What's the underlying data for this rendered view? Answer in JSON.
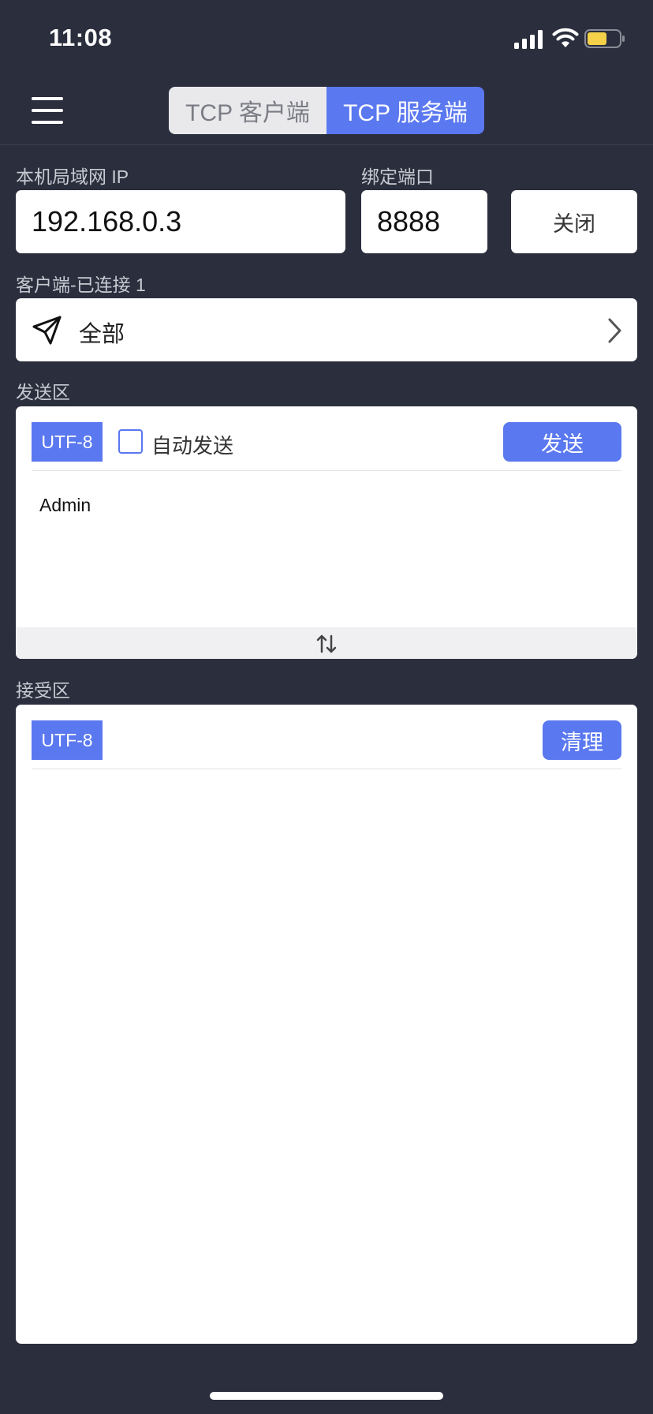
{
  "status_bar": {
    "time": "11:08",
    "icons": [
      "signal-icon",
      "wifi-icon",
      "battery-icon"
    ],
    "battery_color": "#f4d148"
  },
  "nav": {
    "menu_icon": "hamburger-menu-icon",
    "tabs": [
      {
        "label": "TCP 客户端",
        "active": false
      },
      {
        "label": "TCP 服务端",
        "active": true
      }
    ]
  },
  "server": {
    "ip_label": "本机局域网 IP",
    "ip_value": "192.168.0.3",
    "port_label": "绑定端口",
    "port_value": "8888",
    "close_label": "关闭"
  },
  "clients": {
    "label": "客户端-已连接 1",
    "selected": "全部",
    "icon": "send-target-icon"
  },
  "send_area": {
    "label": "发送区",
    "encoding": "UTF-8",
    "auto_send_label": "自动发送",
    "auto_send_checked": false,
    "send_label": "发送",
    "message": "Admin"
  },
  "receive_area": {
    "label": "接受区",
    "encoding": "UTF-8",
    "clear_label": "清理",
    "content": ""
  },
  "colors": {
    "accent": "#5a78ef",
    "background": "#2b2e3d",
    "panel": "#ffffff"
  }
}
